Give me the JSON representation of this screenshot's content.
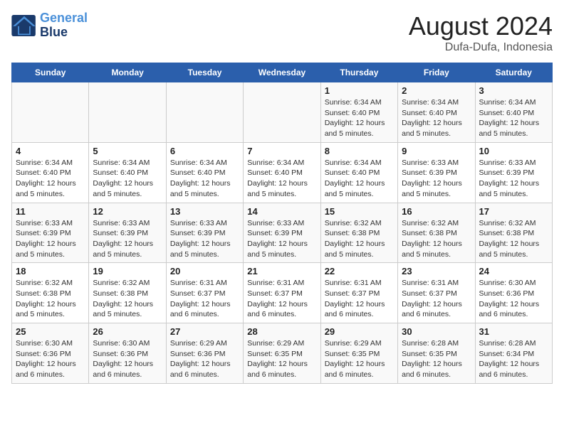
{
  "header": {
    "logo_line1": "General",
    "logo_line2": "Blue",
    "title": "August 2024",
    "subtitle": "Dufa-Dufa, Indonesia"
  },
  "weekdays": [
    "Sunday",
    "Monday",
    "Tuesday",
    "Wednesday",
    "Thursday",
    "Friday",
    "Saturday"
  ],
  "weeks": [
    [
      {
        "day": "",
        "info": ""
      },
      {
        "day": "",
        "info": ""
      },
      {
        "day": "",
        "info": ""
      },
      {
        "day": "",
        "info": ""
      },
      {
        "day": "1",
        "info": "Sunrise: 6:34 AM\nSunset: 6:40 PM\nDaylight: 12 hours\nand 5 minutes."
      },
      {
        "day": "2",
        "info": "Sunrise: 6:34 AM\nSunset: 6:40 PM\nDaylight: 12 hours\nand 5 minutes."
      },
      {
        "day": "3",
        "info": "Sunrise: 6:34 AM\nSunset: 6:40 PM\nDaylight: 12 hours\nand 5 minutes."
      }
    ],
    [
      {
        "day": "4",
        "info": "Sunrise: 6:34 AM\nSunset: 6:40 PM\nDaylight: 12 hours\nand 5 minutes."
      },
      {
        "day": "5",
        "info": "Sunrise: 6:34 AM\nSunset: 6:40 PM\nDaylight: 12 hours\nand 5 minutes."
      },
      {
        "day": "6",
        "info": "Sunrise: 6:34 AM\nSunset: 6:40 PM\nDaylight: 12 hours\nand 5 minutes."
      },
      {
        "day": "7",
        "info": "Sunrise: 6:34 AM\nSunset: 6:40 PM\nDaylight: 12 hours\nand 5 minutes."
      },
      {
        "day": "8",
        "info": "Sunrise: 6:34 AM\nSunset: 6:40 PM\nDaylight: 12 hours\nand 5 minutes."
      },
      {
        "day": "9",
        "info": "Sunrise: 6:33 AM\nSunset: 6:39 PM\nDaylight: 12 hours\nand 5 minutes."
      },
      {
        "day": "10",
        "info": "Sunrise: 6:33 AM\nSunset: 6:39 PM\nDaylight: 12 hours\nand 5 minutes."
      }
    ],
    [
      {
        "day": "11",
        "info": "Sunrise: 6:33 AM\nSunset: 6:39 PM\nDaylight: 12 hours\nand 5 minutes."
      },
      {
        "day": "12",
        "info": "Sunrise: 6:33 AM\nSunset: 6:39 PM\nDaylight: 12 hours\nand 5 minutes."
      },
      {
        "day": "13",
        "info": "Sunrise: 6:33 AM\nSunset: 6:39 PM\nDaylight: 12 hours\nand 5 minutes."
      },
      {
        "day": "14",
        "info": "Sunrise: 6:33 AM\nSunset: 6:39 PM\nDaylight: 12 hours\nand 5 minutes."
      },
      {
        "day": "15",
        "info": "Sunrise: 6:32 AM\nSunset: 6:38 PM\nDaylight: 12 hours\nand 5 minutes."
      },
      {
        "day": "16",
        "info": "Sunrise: 6:32 AM\nSunset: 6:38 PM\nDaylight: 12 hours\nand 5 minutes."
      },
      {
        "day": "17",
        "info": "Sunrise: 6:32 AM\nSunset: 6:38 PM\nDaylight: 12 hours\nand 5 minutes."
      }
    ],
    [
      {
        "day": "18",
        "info": "Sunrise: 6:32 AM\nSunset: 6:38 PM\nDaylight: 12 hours\nand 5 minutes."
      },
      {
        "day": "19",
        "info": "Sunrise: 6:32 AM\nSunset: 6:38 PM\nDaylight: 12 hours\nand 5 minutes."
      },
      {
        "day": "20",
        "info": "Sunrise: 6:31 AM\nSunset: 6:37 PM\nDaylight: 12 hours\nand 6 minutes."
      },
      {
        "day": "21",
        "info": "Sunrise: 6:31 AM\nSunset: 6:37 PM\nDaylight: 12 hours\nand 6 minutes."
      },
      {
        "day": "22",
        "info": "Sunrise: 6:31 AM\nSunset: 6:37 PM\nDaylight: 12 hours\nand 6 minutes."
      },
      {
        "day": "23",
        "info": "Sunrise: 6:31 AM\nSunset: 6:37 PM\nDaylight: 12 hours\nand 6 minutes."
      },
      {
        "day": "24",
        "info": "Sunrise: 6:30 AM\nSunset: 6:36 PM\nDaylight: 12 hours\nand 6 minutes."
      }
    ],
    [
      {
        "day": "25",
        "info": "Sunrise: 6:30 AM\nSunset: 6:36 PM\nDaylight: 12 hours\nand 6 minutes."
      },
      {
        "day": "26",
        "info": "Sunrise: 6:30 AM\nSunset: 6:36 PM\nDaylight: 12 hours\nand 6 minutes."
      },
      {
        "day": "27",
        "info": "Sunrise: 6:29 AM\nSunset: 6:36 PM\nDaylight: 12 hours\nand 6 minutes."
      },
      {
        "day": "28",
        "info": "Sunrise: 6:29 AM\nSunset: 6:35 PM\nDaylight: 12 hours\nand 6 minutes."
      },
      {
        "day": "29",
        "info": "Sunrise: 6:29 AM\nSunset: 6:35 PM\nDaylight: 12 hours\nand 6 minutes."
      },
      {
        "day": "30",
        "info": "Sunrise: 6:28 AM\nSunset: 6:35 PM\nDaylight: 12 hours\nand 6 minutes."
      },
      {
        "day": "31",
        "info": "Sunrise: 6:28 AM\nSunset: 6:34 PM\nDaylight: 12 hours\nand 6 minutes."
      }
    ]
  ]
}
